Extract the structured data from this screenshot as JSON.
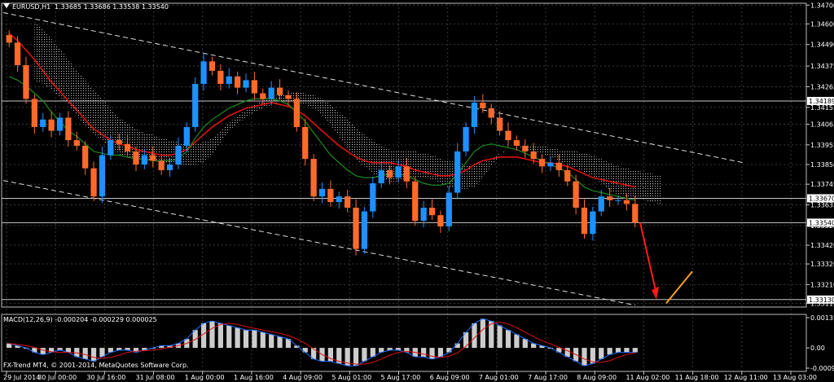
{
  "header": {
    "symbol": "EURUSD,H1",
    "ohlc": "1.33685 1.33686 1.33538 1.33540"
  },
  "watermark": "FX-Trend MT4, © 2001-2014, MetaQuotes Software Corp.",
  "macd": {
    "label": "MACD(12,26,9) -0.000204 -0.000229 0.000025",
    "ticks": [
      "0.001352",
      "0.00",
      "-0.000907"
    ]
  },
  "chart_data": {
    "type": "candlestick",
    "price_axis": {
      "ticks": [
        "1.34700",
        "1.34600",
        "1.34490",
        "1.34375",
        "1.34265",
        "1.34155",
        "1.34065",
        "1.33955",
        "1.33850",
        "1.33745",
        "1.33635",
        "1.33525",
        "1.33420",
        "1.33320",
        "1.33210",
        "1.33110"
      ],
      "markers": [
        {
          "label": "1.34189",
          "price": 1.34189
        },
        {
          "label": "1.33670",
          "price": 1.3367
        },
        {
          "label": "1.33540",
          "price": 1.3354
        },
        {
          "label": "1.33130",
          "price": 1.3313
        }
      ],
      "ylim": [
        1.3309,
        1.3471
      ]
    },
    "time_axis": [
      "29 Jul 2014",
      "30 Jul 00:00",
      "30 Jul 16:00",
      "31 Jul 08:00",
      "1 Aug 00:00",
      "1 Aug 16:00",
      "4 Aug 09:00",
      "5 Aug 01:00",
      "5 Aug 17:00",
      "6 Aug 09:00",
      "7 Aug 01:00",
      "7 Aug 17:00",
      "8 Aug 09:00",
      "11 Aug 02:00",
      "11 Aug 18:00",
      "12 Aug 11:00",
      "13 Aug 03:00"
    ],
    "series": [
      {
        "name": "closes",
        "values": [
          1.345,
          1.3438,
          1.342,
          1.3405,
          1.3409,
          1.3403,
          1.341,
          1.3398,
          1.3395,
          1.3383,
          1.3368,
          1.339,
          1.3398,
          1.3396,
          1.3392,
          1.3385,
          1.339,
          1.3387,
          1.3382,
          1.3385,
          1.3395,
          1.3405,
          1.3428,
          1.344,
          1.3435,
          1.3428,
          1.3432,
          1.3426,
          1.343,
          1.3423,
          1.342,
          1.3426,
          1.3422,
          1.342,
          1.3405,
          1.3388,
          1.3368,
          1.3372,
          1.3365,
          1.3368,
          1.3362,
          1.334,
          1.336,
          1.3375,
          1.3382,
          1.3378,
          1.3384,
          1.3376,
          1.3355,
          1.3362,
          1.3358,
          1.3352,
          1.337,
          1.3392,
          1.3405,
          1.3418,
          1.3415,
          1.341,
          1.3403,
          1.3398,
          1.3395,
          1.3392,
          1.3388,
          1.3384,
          1.3386,
          1.3382,
          1.3376,
          1.3362,
          1.3348,
          1.336,
          1.3368,
          1.3366,
          1.3366,
          1.3364,
          1.3354
        ]
      },
      {
        "name": "ma_fast",
        "values": [
          1.3455,
          1.3451,
          1.3446,
          1.3441,
          1.3435,
          1.3429,
          1.3424,
          1.3419,
          1.3414,
          1.3409,
          1.3404,
          1.3401,
          1.3398,
          1.3396,
          1.3395,
          1.3393,
          1.3392,
          1.3391,
          1.339,
          1.339,
          1.3391,
          1.3393,
          1.3397,
          1.3401,
          1.3405,
          1.3408,
          1.3411,
          1.3413,
          1.3415,
          1.3416,
          1.3417,
          1.3418,
          1.3417,
          1.3416,
          1.3414,
          1.3411,
          1.3407,
          1.3403,
          1.3399,
          1.3395,
          1.3392,
          1.3389,
          1.3387,
          1.3386,
          1.3386,
          1.3386,
          1.3385,
          1.3384,
          1.3382,
          1.3381,
          1.338,
          1.3379,
          1.3379,
          1.338,
          1.3382,
          1.3385,
          1.3387,
          1.3388,
          1.3389,
          1.3389,
          1.3389,
          1.3388,
          1.3387,
          1.3386,
          1.3386,
          1.3385,
          1.3384,
          1.3382,
          1.338,
          1.3378,
          1.3377,
          1.3376,
          1.3375,
          1.3374,
          1.3373
        ]
      },
      {
        "name": "ma_slow",
        "values": [
          1.3432,
          1.343,
          1.3427,
          1.3423,
          1.3419,
          1.3413,
          1.3408,
          1.3403,
          1.34,
          1.3396,
          1.3392,
          1.3391,
          1.339,
          1.339,
          1.3389,
          1.3388,
          1.3388,
          1.3387,
          1.3387,
          1.3387,
          1.3388,
          1.3392,
          1.3399,
          1.3405,
          1.3409,
          1.3412,
          1.3415,
          1.3417,
          1.3419,
          1.342,
          1.342,
          1.342,
          1.3419,
          1.3417,
          1.3413,
          1.3408,
          1.3402,
          1.3396,
          1.339,
          1.3386,
          1.3382,
          1.3379,
          1.3378,
          1.3378,
          1.3379,
          1.338,
          1.338,
          1.3379,
          1.3377,
          1.3375,
          1.3374,
          1.3374,
          1.3375,
          1.338,
          1.3386,
          1.3392,
          1.3395,
          1.3396,
          1.3395,
          1.3394,
          1.3393,
          1.3391,
          1.3389,
          1.3387,
          1.3385,
          1.3383,
          1.3381,
          1.3377,
          1.3373,
          1.3371,
          1.337,
          1.3369,
          1.3368,
          1.3367,
          1.3366
        ]
      },
      {
        "name": "macd",
        "values": [
          0.0002,
          0.0001,
          0.0,
          -0.0002,
          -0.0003,
          -0.0002,
          -0.0001,
          -0.0002,
          -0.0004,
          -0.0005,
          -0.0006,
          -0.0004,
          -0.0002,
          -0.0001,
          -0.0001,
          -0.0002,
          -0.0001,
          0.0,
          0.0001,
          0.0001,
          0.0002,
          0.0004,
          0.0008,
          0.0011,
          0.0012,
          0.0011,
          0.001,
          0.0009,
          0.0008,
          0.0008,
          0.0007,
          0.0006,
          0.0005,
          0.0004,
          0.0001,
          -0.0002,
          -0.0005,
          -0.0006,
          -0.0006,
          -0.0007,
          -0.0008,
          -0.0008,
          -0.0006,
          -0.0004,
          -0.0002,
          -0.0001,
          -0.0001,
          -0.0002,
          -0.0004,
          -0.0004,
          -0.0005,
          -0.0004,
          -0.0002,
          0.0002,
          0.0007,
          0.0011,
          0.0013,
          0.0012,
          0.001,
          0.0008,
          0.0006,
          0.0004,
          0.0002,
          0.0001,
          0.0,
          -0.0002,
          -0.0004,
          -0.0006,
          -0.0008,
          -0.0007,
          -0.0005,
          -0.0003,
          -0.0002,
          -0.0002,
          -0.0002
        ]
      }
    ]
  }
}
